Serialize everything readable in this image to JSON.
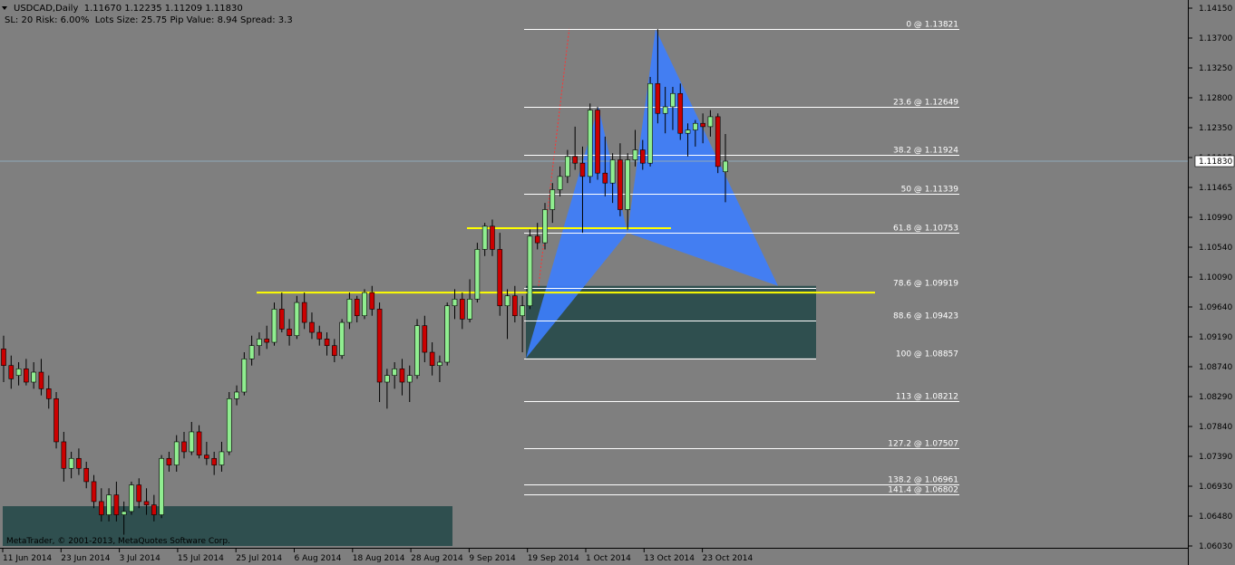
{
  "header": {
    "symbol_line": "USDCAD,Daily  1.11670 1.12235 1.11209 1.11830",
    "info_line": "SL: 20 Risk: 6.00%  Lots Size: 25.75 Pip Value: 8.94 Spread: 3.3"
  },
  "copyright": "MetaTrader, © 2001-2013, MetaQuotes Software Corp.",
  "colors": {
    "background": "#7f7f7f",
    "bull_candle": "#90ee90",
    "bear_candle": "#cc0000",
    "wick": "#000000",
    "pattern_fill": "#3d7eff",
    "zone_fill": "#2f4f4f",
    "level_line": "#ffffff",
    "support_line": "#ffff00",
    "current_price_line": "#8fa8b8",
    "trend_line": "#ff3333"
  },
  "price_axis": {
    "ticks": [
      "1.14150",
      "1.13700",
      "1.13250",
      "1.12800",
      "1.12350",
      "1.11915",
      "1.11465",
      "1.10990",
      "1.10540",
      "1.10090",
      "1.09640",
      "1.09190",
      "1.08740",
      "1.08290",
      "1.07840",
      "1.07390",
      "1.06930",
      "1.06480",
      "1.06030"
    ],
    "current_price": "1.11830"
  },
  "time_axis": {
    "labels": [
      "11 Jun 2014",
      "23 Jun 2014",
      "3 Jul 2014",
      "15 Jul 2014",
      "25 Jul 2014",
      "6 Aug 2014",
      "18 Aug 2014",
      "28 Aug 2014",
      "9 Sep 2014",
      "19 Sep 2014",
      "1 Oct 2014",
      "13 Oct 2014",
      "23 Oct 2014"
    ]
  },
  "chart_data": {
    "type": "candlestick",
    "symbol": "USDCAD",
    "timeframe": "Daily",
    "ylim": [
      1.0603,
      1.1415
    ],
    "last": {
      "open": 1.1167,
      "high": 1.12235,
      "low": 1.11209,
      "close": 1.1183
    },
    "fib_levels": [
      {
        "label": "0 @ 1.13821",
        "price": 1.13821
      },
      {
        "label": "23.6 @ 1.12649",
        "price": 1.12649
      },
      {
        "label": "38.2 @ 1.11924",
        "price": 1.11924
      },
      {
        "label": "50 @ 1.11339",
        "price": 1.11339
      },
      {
        "label": "61.8 @ 1.10753",
        "price": 1.10753
      },
      {
        "label": "78.6 @ 1.09919",
        "price": 1.09919
      },
      {
        "label": "88.6 @ 1.09423",
        "price": 1.09423
      },
      {
        "label": "100 @ 1.08857",
        "price": 1.08857
      },
      {
        "label": "113  @ 1.08212",
        "price": 1.08212
      },
      {
        "label": "127.2 @ 1.07507",
        "price": 1.07507
      },
      {
        "label": "138.2 @ 1.06961",
        "price": 1.06961
      },
      {
        "label": "141.4 @ 1.06802",
        "price": 1.06802
      }
    ],
    "support_lines": [
      1.1082,
      1.0985
    ],
    "candles": [
      [
        1.09,
        1.092,
        1.085,
        1.0875
      ],
      [
        1.0875,
        1.089,
        1.084,
        1.0855
      ],
      [
        1.086,
        1.088,
        1.0845,
        1.087
      ],
      [
        1.087,
        1.0885,
        1.0845,
        1.085
      ],
      [
        1.085,
        1.088,
        1.084,
        1.0865
      ],
      [
        1.0865,
        1.0885,
        1.083,
        1.084
      ],
      [
        1.084,
        1.086,
        1.081,
        1.0825
      ],
      [
        1.0825,
        1.0835,
        1.075,
        1.076
      ],
      [
        1.076,
        1.0775,
        1.07,
        1.072
      ],
      [
        1.072,
        1.0745,
        1.0705,
        1.0735
      ],
      [
        1.0735,
        1.075,
        1.071,
        1.072
      ],
      [
        1.072,
        1.073,
        1.069,
        1.07
      ],
      [
        1.07,
        1.071,
        1.066,
        1.067
      ],
      [
        1.067,
        1.069,
        1.064,
        1.065
      ],
      [
        1.065,
        1.069,
        1.064,
        1.068
      ],
      [
        1.068,
        1.07,
        1.064,
        1.065
      ],
      [
        1.065,
        1.067,
        1.062,
        1.0655
      ],
      [
        1.0655,
        1.07,
        1.065,
        1.0695
      ],
      [
        1.0695,
        1.0705,
        1.066,
        1.067
      ],
      [
        1.067,
        1.069,
        1.065,
        1.0665
      ],
      [
        1.0665,
        1.068,
        1.064,
        1.065
      ],
      [
        1.065,
        1.074,
        1.0645,
        1.0735
      ],
      [
        1.0735,
        1.0745,
        1.0715,
        1.0725
      ],
      [
        1.0725,
        1.077,
        1.0715,
        1.076
      ],
      [
        1.076,
        1.0775,
        1.0735,
        1.0745
      ],
      [
        1.0745,
        1.079,
        1.074,
        1.0775
      ],
      [
        1.0775,
        1.0785,
        1.0735,
        1.074
      ],
      [
        1.074,
        1.076,
        1.0725,
        1.0735
      ],
      [
        1.0735,
        1.0745,
        1.071,
        1.0725
      ],
      [
        1.0725,
        1.076,
        1.0715,
        1.0745
      ],
      [
        1.0745,
        1.0835,
        1.074,
        1.0825
      ],
      [
        1.0825,
        1.0845,
        1.0815,
        1.0835
      ],
      [
        1.0835,
        1.0895,
        1.083,
        1.0885
      ],
      [
        1.0885,
        1.092,
        1.0875,
        1.0905
      ],
      [
        1.0905,
        1.0925,
        1.089,
        1.0915
      ],
      [
        1.0915,
        1.0935,
        1.09,
        1.091
      ],
      [
        1.091,
        1.097,
        1.0905,
        1.096
      ],
      [
        1.096,
        1.0985,
        1.0925,
        1.093
      ],
      [
        1.093,
        1.0945,
        1.0905,
        1.092
      ],
      [
        1.092,
        1.098,
        1.0915,
        1.097
      ],
      [
        1.097,
        1.0985,
        1.093,
        1.094
      ],
      [
        1.094,
        1.0955,
        1.0915,
        1.0925
      ],
      [
        1.0925,
        1.0935,
        1.0905,
        1.0915
      ],
      [
        1.0915,
        1.0925,
        1.089,
        1.0905
      ],
      [
        1.0905,
        1.0915,
        1.088,
        1.089
      ],
      [
        1.089,
        1.0945,
        1.0885,
        1.094
      ],
      [
        1.094,
        1.0985,
        1.093,
        1.0975
      ],
      [
        1.0975,
        1.098,
        1.094,
        1.095
      ],
      [
        1.095,
        1.099,
        1.0945,
        1.0985
      ],
      [
        1.0985,
        1.0995,
        1.095,
        1.096
      ],
      [
        1.096,
        1.097,
        1.082,
        1.085
      ],
      [
        1.085,
        1.087,
        1.081,
        1.086
      ],
      [
        1.086,
        1.088,
        1.084,
        1.087
      ],
      [
        1.087,
        1.0885,
        1.083,
        1.085
      ],
      [
        1.085,
        1.0875,
        1.082,
        1.086
      ],
      [
        1.086,
        1.0945,
        1.0855,
        1.0935
      ],
      [
        1.0935,
        1.095,
        1.088,
        1.0895
      ],
      [
        1.0895,
        1.091,
        1.086,
        1.0875
      ],
      [
        1.0875,
        1.089,
        1.085,
        1.088
      ],
      [
        1.088,
        1.097,
        1.0875,
        1.0965
      ],
      [
        1.0965,
        1.099,
        1.0945,
        1.0975
      ],
      [
        1.0975,
        1.0985,
        1.093,
        1.0945
      ],
      [
        1.0945,
        1.1005,
        1.094,
        1.0975
      ],
      [
        1.0975,
        1.106,
        1.097,
        1.105
      ],
      [
        1.105,
        1.109,
        1.104,
        1.1085
      ],
      [
        1.1085,
        1.1095,
        1.104,
        1.105
      ],
      [
        1.105,
        1.1075,
        1.095,
        1.0965
      ],
      [
        1.0965,
        1.099,
        1.0915,
        1.098
      ],
      [
        1.098,
        1.0995,
        1.094,
        1.095
      ],
      [
        1.095,
        1.098,
        1.0895,
        1.0965
      ],
      [
        1.0965,
        1.108,
        1.096,
        1.107
      ],
      [
        1.107,
        1.109,
        1.105,
        1.106
      ],
      [
        1.106,
        1.112,
        1.105,
        1.111
      ],
      [
        1.111,
        1.115,
        1.109,
        1.114
      ],
      [
        1.114,
        1.1175,
        1.113,
        1.116
      ],
      [
        1.116,
        1.12,
        1.115,
        1.119
      ],
      [
        1.119,
        1.1235,
        1.117,
        1.118
      ],
      [
        1.118,
        1.1205,
        1.1075,
        1.116
      ],
      [
        1.116,
        1.127,
        1.115,
        1.126
      ],
      [
        1.126,
        1.1265,
        1.1155,
        1.1165
      ],
      [
        1.1165,
        1.122,
        1.113,
        1.115
      ],
      [
        1.115,
        1.1195,
        1.112,
        1.1185
      ],
      [
        1.1185,
        1.121,
        1.11,
        1.111
      ],
      [
        1.111,
        1.1195,
        1.108,
        1.1185
      ],
      [
        1.1185,
        1.123,
        1.1175,
        1.12
      ],
      [
        1.12,
        1.1215,
        1.117,
        1.118
      ],
      [
        1.118,
        1.131,
        1.1175,
        1.13
      ],
      [
        1.13,
        1.1382,
        1.124,
        1.1255
      ],
      [
        1.1255,
        1.1295,
        1.1225,
        1.1265
      ],
      [
        1.1265,
        1.1295,
        1.123,
        1.1285
      ],
      [
        1.1285,
        1.13,
        1.1215,
        1.1225
      ],
      [
        1.1225,
        1.124,
        1.119,
        1.123
      ],
      [
        1.123,
        1.1245,
        1.1205,
        1.124
      ],
      [
        1.124,
        1.1255,
        1.121,
        1.1235
      ],
      [
        1.1235,
        1.126,
        1.122,
        1.125
      ],
      [
        1.125,
        1.1255,
        1.1165,
        1.1175
      ],
      [
        1.1167,
        1.1224,
        1.1121,
        1.1183
      ]
    ]
  }
}
